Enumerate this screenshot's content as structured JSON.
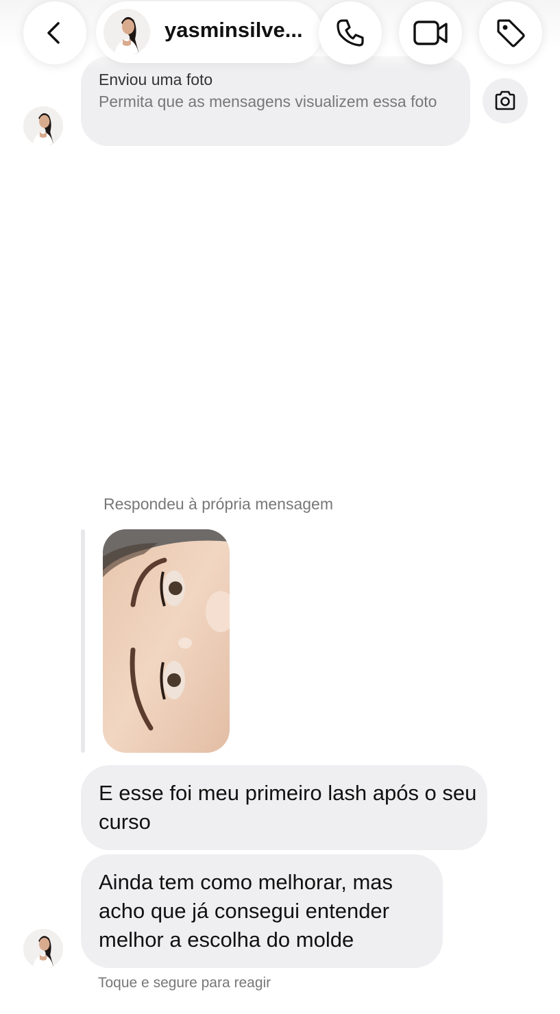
{
  "header": {
    "username": "yasminsilve...",
    "icons": {
      "back": "chevron-left-icon",
      "call": "phone-icon",
      "video": "video-camera-icon",
      "tag": "tag-icon"
    }
  },
  "messages": {
    "photo_card": {
      "title": "Enviou uma foto",
      "subtitle": "Permita que as mensagens visualizem essa foto",
      "action_icon": "camera-icon"
    },
    "reply_label": "Respondeu à própria mensagem",
    "text_1": "E esse foi meu primeiro lash após o seu curso",
    "text_2": "Ainda tem como melhorar, mas acho que já consegui entender melhor a escolha do molde",
    "hint": "Toque e segure para reagir"
  },
  "colors": {
    "bubble": "#efeff1",
    "text": "#111111",
    "muted": "#777777"
  }
}
